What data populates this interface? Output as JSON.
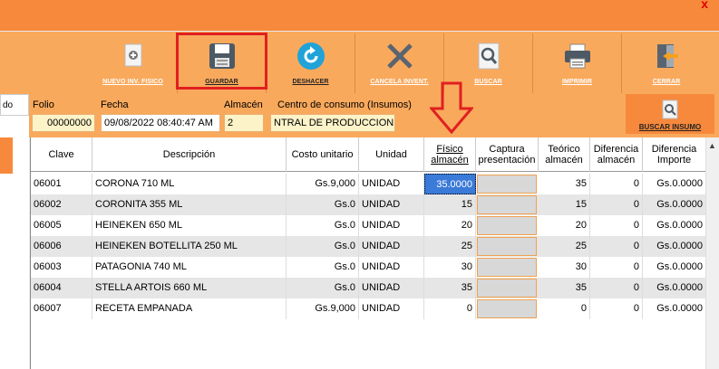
{
  "window": {
    "close_glyph": "x"
  },
  "toolbar": {
    "buttons": [
      {
        "label": "NUEVO INV. FISICO",
        "icon": "new-document-icon"
      },
      {
        "label": "GUARDAR",
        "icon": "save-icon"
      },
      {
        "label": "DESHACER",
        "icon": "undo-icon"
      },
      {
        "label": "CANCELA INVENT.",
        "icon": "cancel-x-icon"
      },
      {
        "label": "BUSCAR",
        "icon": "search-document-icon"
      },
      {
        "label": "IMPRIMIR",
        "icon": "printer-icon"
      },
      {
        "label": "CERRAR",
        "icon": "exit-door-icon"
      }
    ]
  },
  "side": {
    "tab_label": "do"
  },
  "form": {
    "folio_label": "Folio",
    "folio_value": "00000000",
    "fecha_label": "Fecha",
    "fecha_value": "09/08/2022 08:40:47 AM",
    "almacen_label": "Almacén",
    "almacen_value": "2",
    "centro_label": "Centro de consumo (Insumos)",
    "centro_value": "NTRAL DE PRODUCCION",
    "buscar_insumo_label": "BUSCAR INSUMO"
  },
  "grid": {
    "headers": [
      "Clave",
      "Descripción",
      "Costo unitario",
      "Unidad",
      "Físico almacén",
      "Captura presentación",
      "Teórico almacén",
      "Diferencia almacén",
      "Diferencia Importe"
    ],
    "rows": [
      {
        "clave": "06001",
        "descripcion": "CORONA 710 ML",
        "costo": "Gs.9,000",
        "unidad": "UNIDAD",
        "fisico": "35.0000",
        "captura": "",
        "teorico": "35",
        "dif_alm": "0",
        "dif_imp": "Gs.0.0000"
      },
      {
        "clave": "06002",
        "descripcion": "CORONITA 355 ML",
        "costo": "Gs.0",
        "unidad": "UNIDAD",
        "fisico": "15",
        "captura": "",
        "teorico": "15",
        "dif_alm": "0",
        "dif_imp": "Gs.0.0000"
      },
      {
        "clave": "06005",
        "descripcion": "HEINEKEN 650 ML",
        "costo": "Gs.0",
        "unidad": "UNIDAD",
        "fisico": "20",
        "captura": "",
        "teorico": "20",
        "dif_alm": "0",
        "dif_imp": "Gs.0.0000"
      },
      {
        "clave": "06006",
        "descripcion": "HEINEKEN BOTELLITA 250 ML",
        "costo": "Gs.0",
        "unidad": "UNIDAD",
        "fisico": "25",
        "captura": "",
        "teorico": "25",
        "dif_alm": "0",
        "dif_imp": "Gs.0.0000"
      },
      {
        "clave": "06003",
        "descripcion": "PATAGONIA 740 ML",
        "costo": "Gs.0",
        "unidad": "UNIDAD",
        "fisico": "30",
        "captura": "",
        "teorico": "30",
        "dif_alm": "0",
        "dif_imp": "Gs.0.0000"
      },
      {
        "clave": "06004",
        "descripcion": "STELLA ARTOIS 660 ML",
        "costo": "Gs.0",
        "unidad": "UNIDAD",
        "fisico": "35",
        "captura": "",
        "teorico": "35",
        "dif_alm": "0",
        "dif_imp": "Gs.0.0000"
      },
      {
        "clave": "06007",
        "descripcion": "RECETA EMPANADA",
        "costo": "Gs.9,000",
        "unidad": "UNIDAD",
        "fisico": "0",
        "captura": "",
        "teorico": "0",
        "dif_alm": "0",
        "dif_imp": "Gs.0.0000"
      }
    ]
  },
  "colors": {
    "title_bar": "#f7893c",
    "toolbar": "#f9a95c",
    "annotation_red": "#e02020",
    "selected_cell": "#3a7ad8"
  }
}
